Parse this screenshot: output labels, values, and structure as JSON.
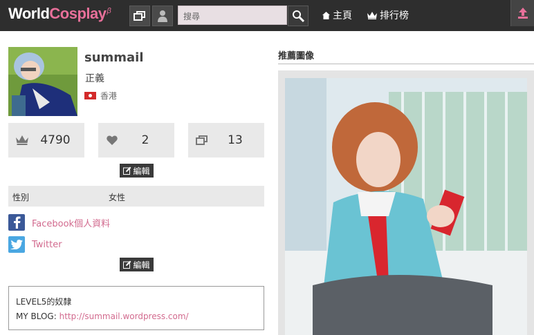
{
  "header": {
    "logo_main": "World",
    "logo_accent": "Cosplay",
    "logo_beta": "β",
    "search_placeholder": "搜尋",
    "nav_home": "主頁",
    "nav_ranking": "排行榜"
  },
  "profile": {
    "username": "summail",
    "title": "正義",
    "location": "香港",
    "stats": {
      "ranking": "4790",
      "likes": "2",
      "photos": "13"
    },
    "edit_label": "編輯",
    "info": {
      "gender_label": "性別",
      "gender_value": "女性"
    },
    "links": {
      "facebook": "Facebook個人資料",
      "twitter": "Twitter"
    },
    "bio": {
      "line1": "LEVEL5的奴隸",
      "blog_label": "MY BLOG:",
      "blog_url": "http://summail.wordpress.com/"
    }
  },
  "recommended": {
    "heading": "推薦圖像"
  },
  "colors": {
    "header_bg": "#2e2e2e",
    "accent_pink": "#e8709a",
    "link_pink": "#d26a8e",
    "stat_bg": "#e9e9e9"
  }
}
